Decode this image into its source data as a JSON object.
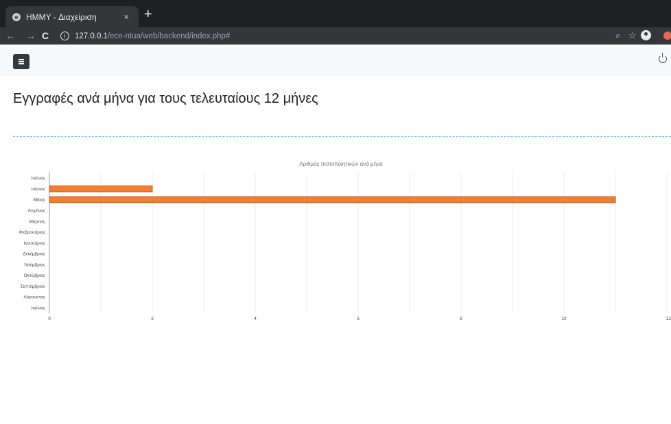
{
  "browser": {
    "tab_title": "HMMY - Διαχείριση",
    "tab_close": "×",
    "new_tab": "+",
    "back": "←",
    "forward": "→",
    "reload": "C",
    "url_host": "127.0.0.1",
    "url_path": "/ece-ntua/web/backend/index.php#",
    "zoom_icon": "⌕",
    "bookmark_icon": "☆"
  },
  "page": {
    "title": "Εγγραφές ανά μήνα για τους τελευταίους 12 μήνες"
  },
  "chart_data": {
    "type": "bar",
    "orientation": "horizontal",
    "title": "Αριθμός πιστοποιητικών ανά μήνα",
    "categories": [
      "Ιούλιος",
      "Ιούνιος",
      "Μάιος",
      "Απρίλιος",
      "Μάρτιος",
      "Φεβρουάριος",
      "Ιανουάριος",
      "Δεκέμβριος",
      "Νοέμβριος",
      "Οκτώβριος",
      "Σεπτέμβριος",
      "Αύγουστος",
      "Ιούλιος"
    ],
    "values": [
      0,
      2,
      11,
      0,
      0,
      0,
      0,
      0,
      0,
      0,
      0,
      0,
      0
    ],
    "xlim": [
      0,
      12
    ],
    "xticks": [
      "0",
      "2",
      "4",
      "6",
      "8",
      "10",
      "12"
    ],
    "bar_color": "#f08034",
    "grid": true
  }
}
